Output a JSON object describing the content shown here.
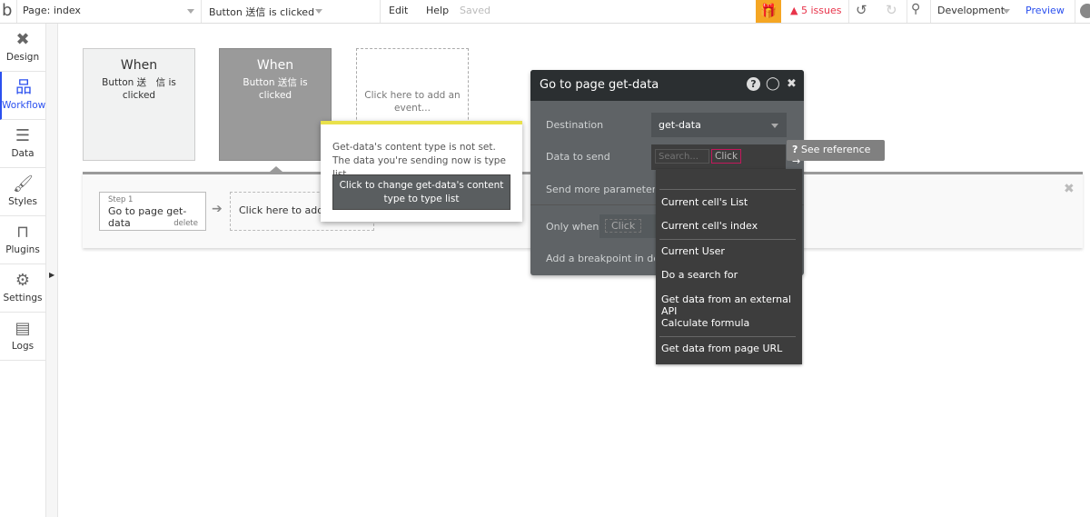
{
  "topbar": {
    "logo": "b",
    "page": "Page: index",
    "event": "Button 送信 is clicked",
    "edit": "Edit",
    "help": "Help",
    "saved": "Saved",
    "issues": "5 issues",
    "environment": "Development",
    "preview": "Preview",
    "accent": "#f5a623",
    "issues_color": "#e8334a"
  },
  "sidebar": {
    "items": [
      {
        "label": "Design",
        "icon": "design-icon"
      },
      {
        "label": "Workflow",
        "icon": "workflow-icon"
      },
      {
        "label": "Data",
        "icon": "database-icon"
      },
      {
        "label": "Styles",
        "icon": "brush-icon"
      },
      {
        "label": "Plugins",
        "icon": "plug-icon"
      },
      {
        "label": "Settings",
        "icon": "gear-icon"
      },
      {
        "label": "Logs",
        "icon": "document-icon"
      }
    ]
  },
  "events": [
    {
      "when": "When",
      "desc": "Button 送　信 is clicked"
    },
    {
      "when": "When",
      "desc": "Button 送信 is clicked"
    },
    {
      "add": "Click here to add an event..."
    }
  ],
  "steps": {
    "step_label": "Step 1",
    "step_title": "Go to page get-data",
    "delete": "delete",
    "add": "Click here to add an action..."
  },
  "warning": {
    "text": "Get-data's content type is not set. The data you're sending now is type list.",
    "button": "Click to change get-data's content type to type list"
  },
  "panel": {
    "title": "Go to page get-data",
    "destination_label": "Destination",
    "destination_value": "get-data",
    "data_label": "Data to send",
    "search_placeholder": "Search...",
    "click": "Click",
    "more_params": "Send more parameters to the page",
    "only_when": "Only when",
    "only_when_click": "Click",
    "breakpoint": "Add a breakpoint in debug mode"
  },
  "reference": "See reference →",
  "dropdown": {
    "items": [
      "Current cell's List",
      "Current cell's index",
      "Current User",
      "Do a search for",
      "Get data from an external API",
      "Calculate formula",
      "Get data from page URL"
    ]
  }
}
